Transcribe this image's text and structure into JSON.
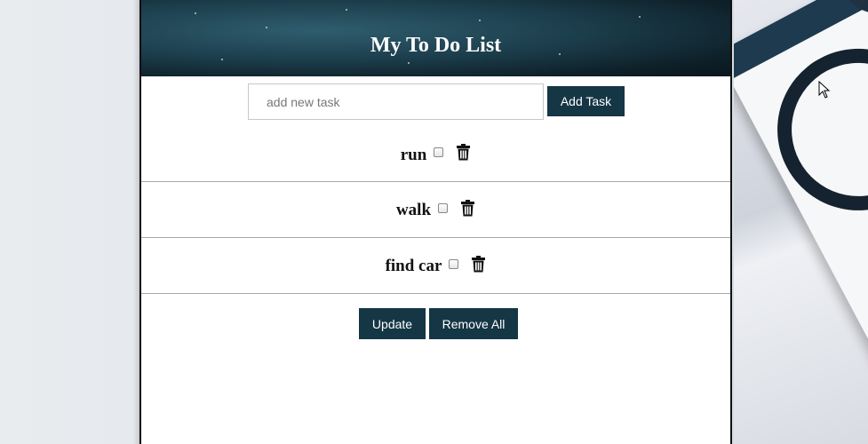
{
  "header": {
    "title": "My To Do List"
  },
  "new_task": {
    "placeholder": "add new task",
    "value": "",
    "add_label": "Add Task"
  },
  "tasks": [
    {
      "label": "run",
      "checked": false
    },
    {
      "label": "walk",
      "checked": false
    },
    {
      "label": "find car",
      "checked": false
    }
  ],
  "actions": {
    "update_label": "Update",
    "remove_all_label": "Remove All"
  },
  "icons": {
    "delete": "trash-icon",
    "checkbox": "checkbox"
  },
  "colors": {
    "button": "#153645",
    "header_dark": "#0e2029",
    "header_light": "#2f5d6e"
  }
}
